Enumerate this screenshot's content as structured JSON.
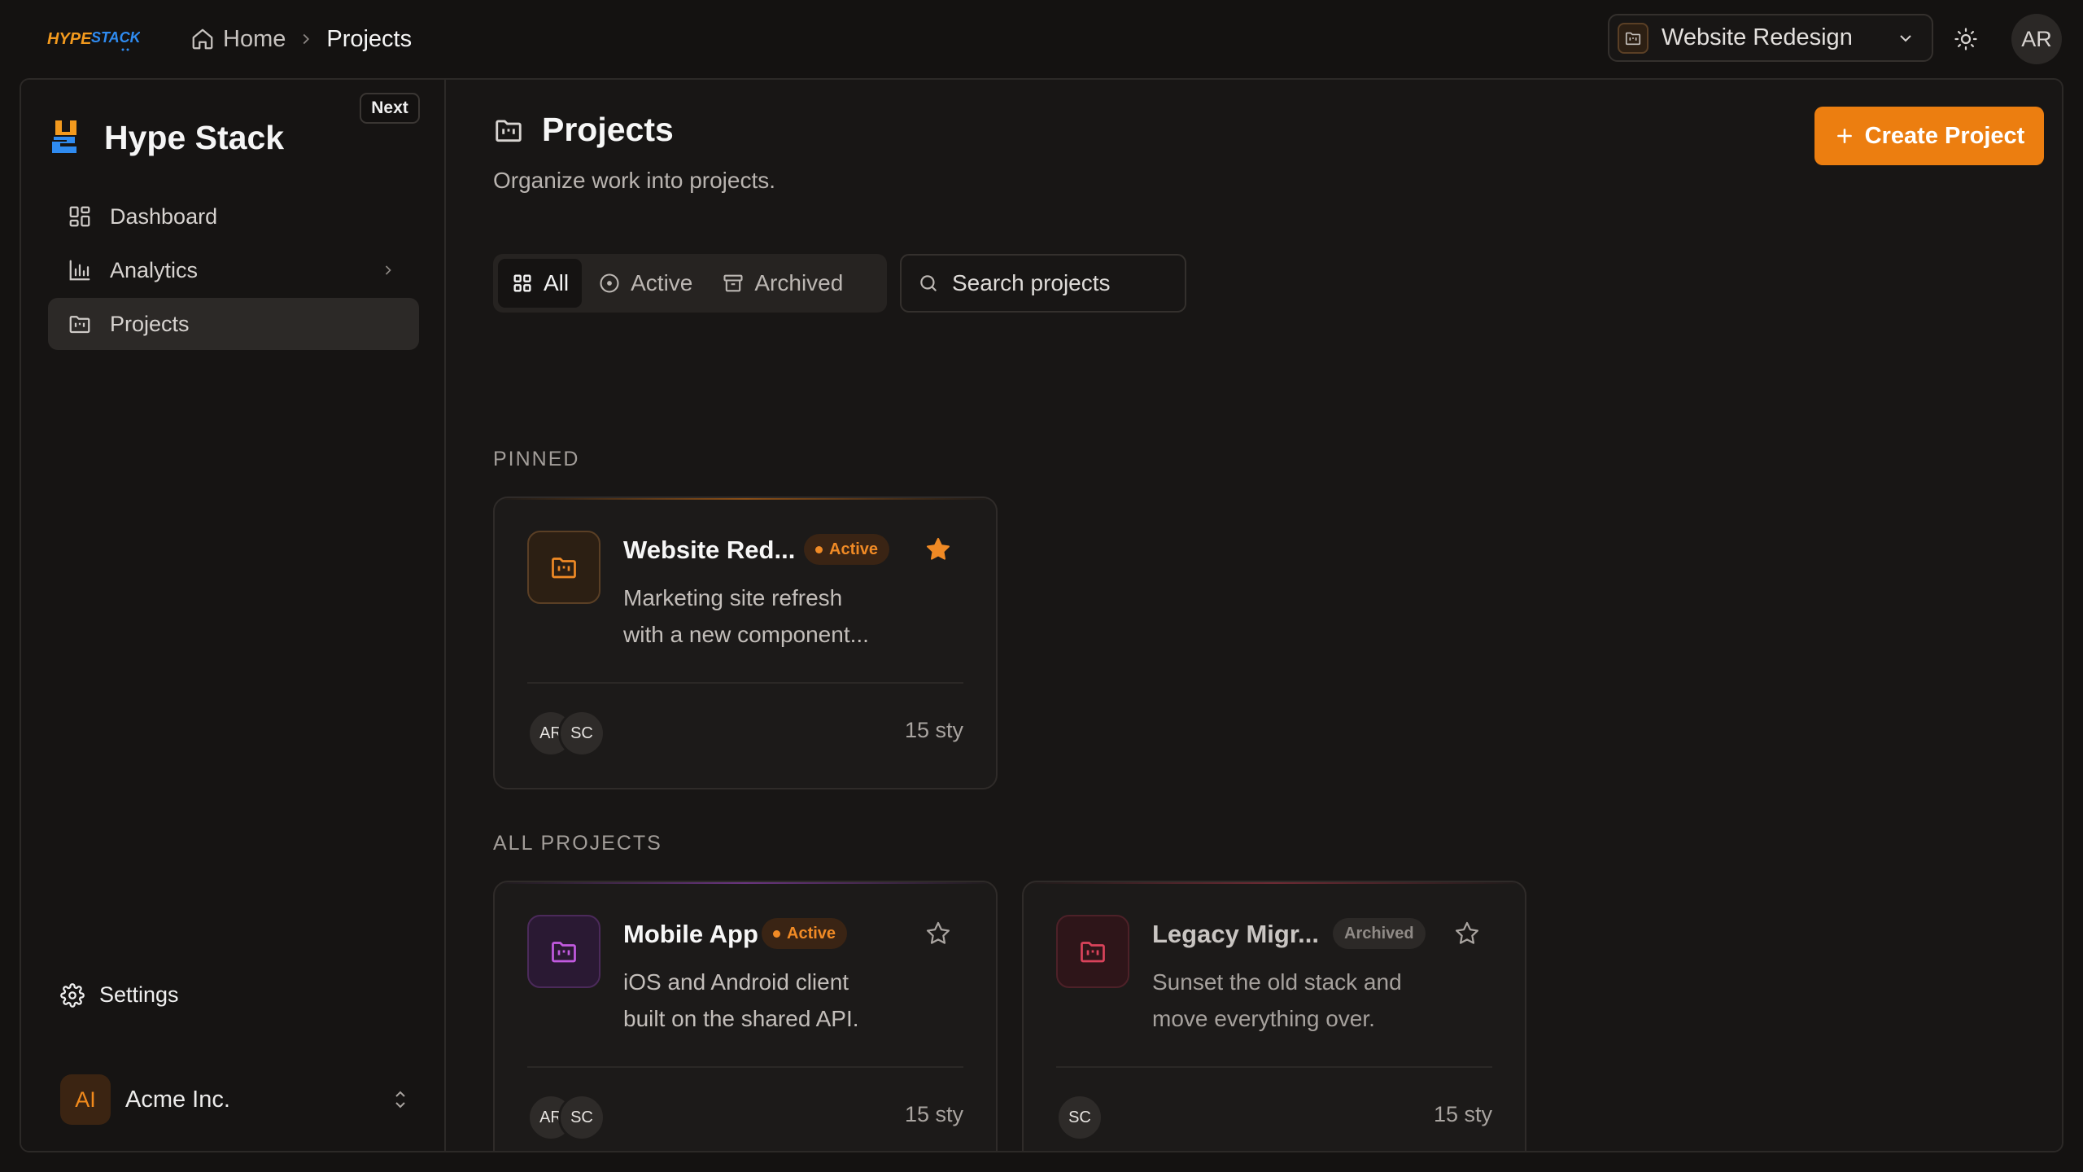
{
  "topbar": {
    "brand": "HYPE STACK",
    "breadcrumb": {
      "home": "Home",
      "current": "Projects"
    },
    "project_select": "Website Redesign",
    "avatar": "AR"
  },
  "sidebar": {
    "title": "Hype Stack",
    "badge": "Next",
    "items": [
      {
        "label": "Dashboard",
        "icon": "dashboard-icon"
      },
      {
        "label": "Analytics",
        "icon": "bar-chart-icon"
      },
      {
        "label": "Projects",
        "icon": "folder-kanban-icon"
      }
    ],
    "settings": "Settings",
    "org": {
      "initials": "AI",
      "name": "Acme Inc."
    }
  },
  "main": {
    "title": "Projects",
    "subtitle": "Organize work into projects.",
    "create_button": "Create Project",
    "filters": [
      {
        "label": "All"
      },
      {
        "label": "Active"
      },
      {
        "label": "Archived"
      }
    ],
    "search_placeholder": "Search projects",
    "pinned_label": "PINNED",
    "all_label": "ALL PROJECTS",
    "pinned": [
      {
        "name": "Website Red...",
        "status": "Active",
        "description": "Marketing site refresh with a new component...",
        "members": [
          "AR",
          "SC"
        ],
        "stories": "15 sty",
        "starred": true
      }
    ],
    "projects": [
      {
        "name": "Mobile App",
        "status": "Active",
        "description": "iOS and Android client built on the shared API.",
        "members": [
          "AR",
          "SC"
        ],
        "stories": "15 sty",
        "starred": false
      },
      {
        "name": "Legacy Migr...",
        "status": "Archived",
        "description": "Sunset the old stack and move everything over.",
        "members": [
          "SC"
        ],
        "stories": "15 sty",
        "starred": false
      }
    ]
  },
  "colors": {
    "accent": "#ec7e10",
    "orange_tile": "#2c1f13",
    "purple_tile": "#2a1933",
    "red_tile": "#2e1519"
  }
}
